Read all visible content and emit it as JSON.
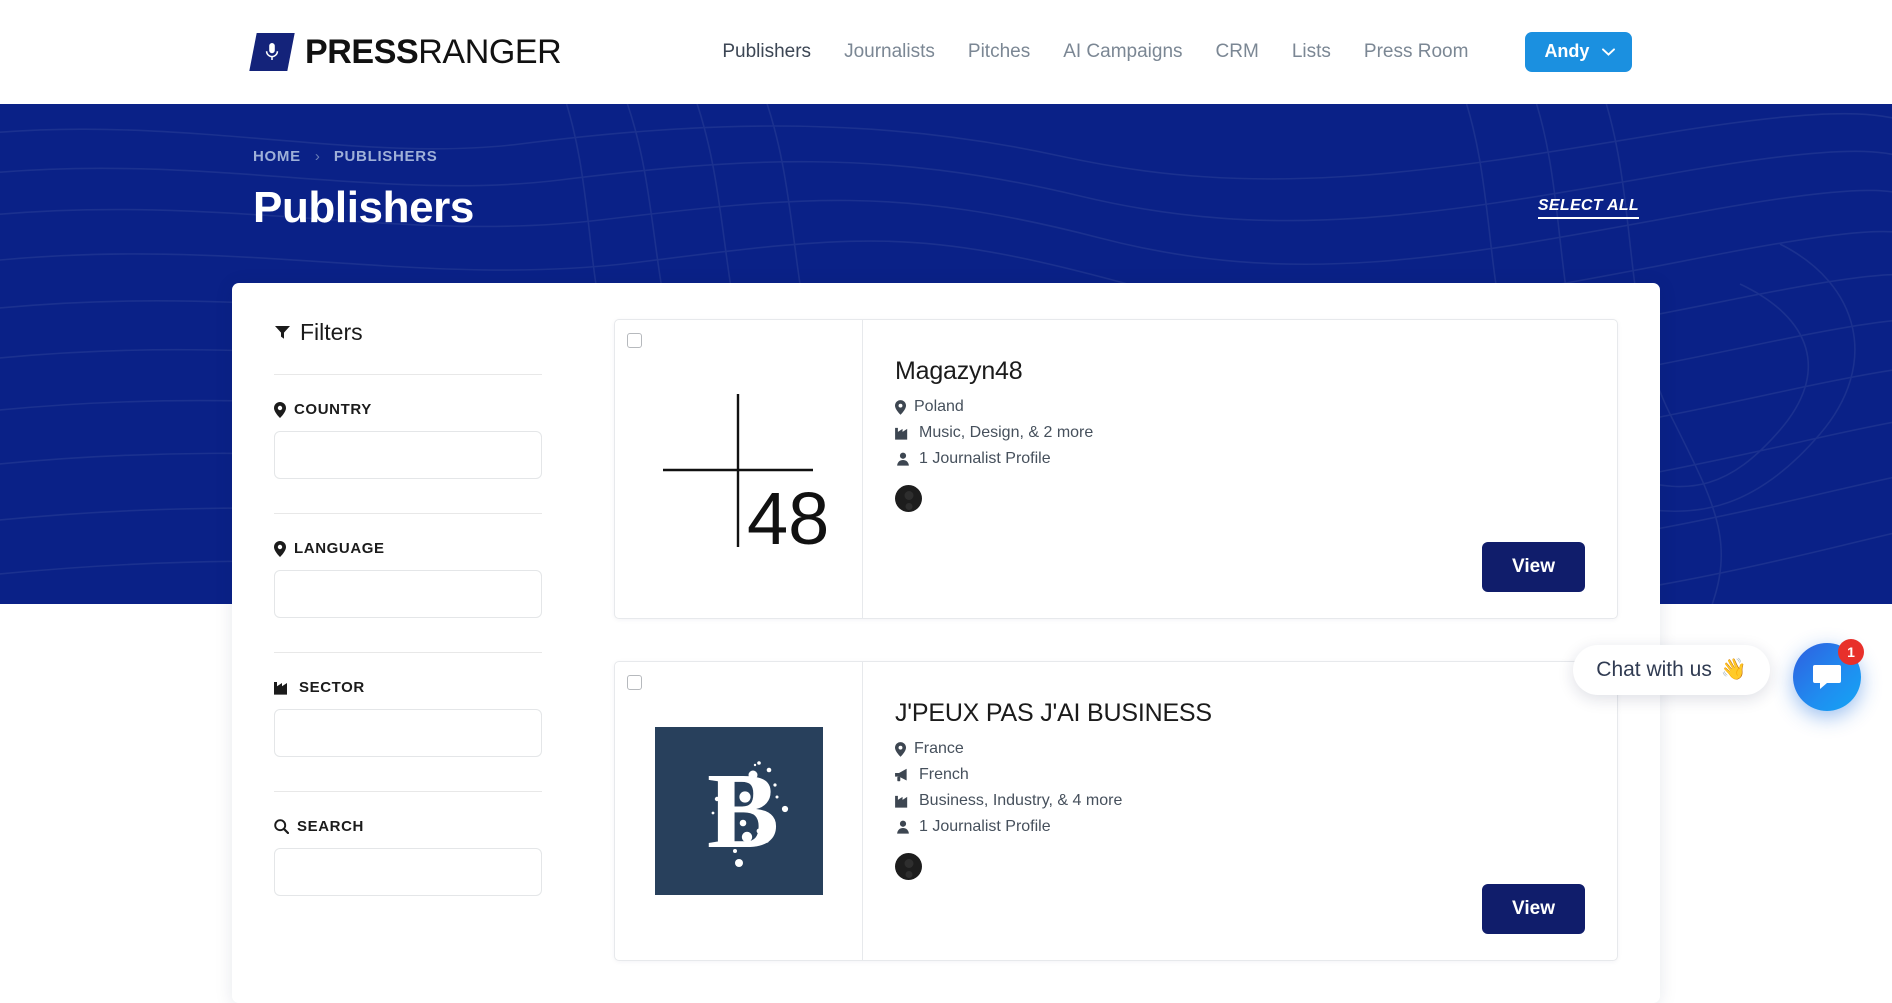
{
  "header": {
    "logo": {
      "icon": "microphone-icon",
      "bold_word": "PRESS",
      "light_word": "RANGER"
    },
    "nav": [
      {
        "label": "Publishers",
        "active": true
      },
      {
        "label": "Journalists",
        "active": false
      },
      {
        "label": "Pitches",
        "active": false
      },
      {
        "label": "AI Campaigns",
        "active": false
      },
      {
        "label": "CRM",
        "active": false
      },
      {
        "label": "Lists",
        "active": false
      },
      {
        "label": "Press Room",
        "active": false
      }
    ],
    "user_button": {
      "label": "Andy",
      "icon": "chevron-down-icon",
      "color": "#1b90e0"
    }
  },
  "hero": {
    "breadcrumb": {
      "home": "HOME",
      "separator": "›",
      "current": "PUBLISHERS"
    },
    "title": "Publishers",
    "select_all": "SELECT ALL",
    "background_color": "#0a2187"
  },
  "filters": {
    "heading": "Filters",
    "heading_icon": "filter-funnel-icon",
    "fields": [
      {
        "label": "COUNTRY",
        "icon": "map-pin-icon",
        "value": "",
        "placeholder": ""
      },
      {
        "label": "LANGUAGE",
        "icon": "map-pin-icon",
        "value": "",
        "placeholder": ""
      },
      {
        "label": "SECTOR",
        "icon": "factory-icon",
        "value": "",
        "placeholder": ""
      },
      {
        "label": "SEARCH",
        "icon": "search-icon",
        "value": "",
        "placeholder": ""
      }
    ]
  },
  "publishers": [
    {
      "name": "Magazyn48",
      "logo_type": "cross-48-logo",
      "logo_text": "48",
      "country": {
        "icon": "map-pin-icon",
        "text": "Poland"
      },
      "language": null,
      "sectors": {
        "icon": "factory-icon",
        "text": "Music, Design, & 2 more"
      },
      "journalists": {
        "icon": "users-icon",
        "text": "1 Journalist Profile"
      },
      "avatars": 1,
      "view_label": "View",
      "selected": false
    },
    {
      "name": "J'PEUX PAS J'AI BUSINESS",
      "logo_type": "letter-b-logo",
      "logo_text": "B",
      "logo_bg": "#28405c",
      "country": {
        "icon": "map-pin-icon",
        "text": "France"
      },
      "language": {
        "icon": "bullhorn-icon",
        "text": "French"
      },
      "sectors": {
        "icon": "factory-icon",
        "text": "Business, Industry, & 4 more"
      },
      "journalists": {
        "icon": "users-icon",
        "text": "1 Journalist Profile"
      },
      "avatars": 1,
      "view_label": "View",
      "selected": false
    }
  ],
  "chat": {
    "pill_text": "Chat with us",
    "pill_emoji": "👋",
    "fab_icon": "chat-bubble-icon",
    "badge_count": "1",
    "badge_color": "#e8302b"
  }
}
